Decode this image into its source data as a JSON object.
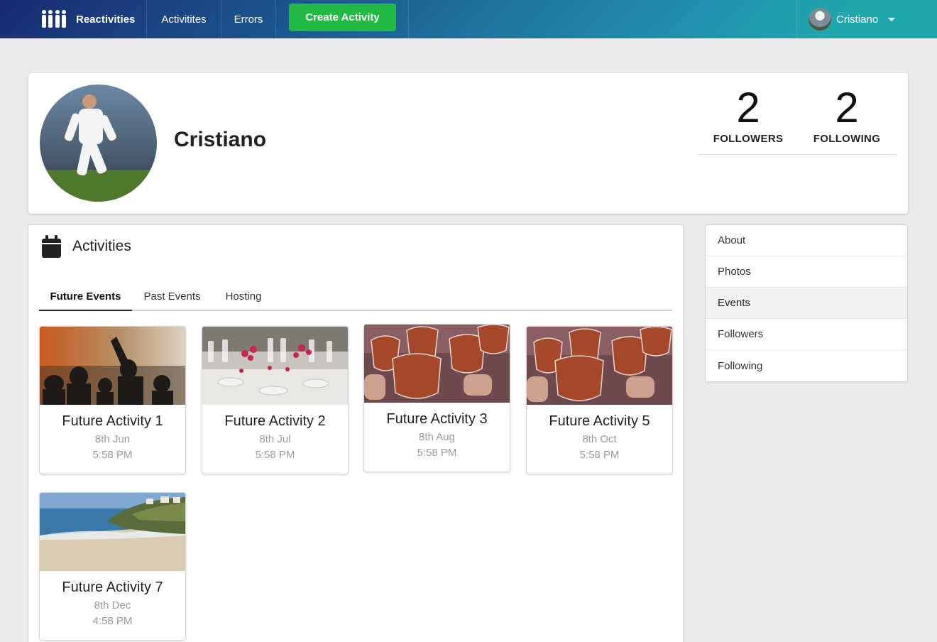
{
  "nav": {
    "brand": "Reactivities",
    "activities": "Activitites",
    "errors": "Errors",
    "create": "Create Activity",
    "user": "Cristiano"
  },
  "profile": {
    "name": "Cristiano",
    "followers_count": "2",
    "followers_label": "FOLLOWERS",
    "following_count": "2",
    "following_label": "FOLLOWING"
  },
  "activities": {
    "title": "Activities",
    "tabs": [
      "Future Events",
      "Past Events",
      "Hosting"
    ],
    "active_tab": "Future Events",
    "events": [
      {
        "title": "Future Activity 1",
        "date": "8th Jun",
        "time": "5:58 PM",
        "image": "concert"
      },
      {
        "title": "Future Activity 2",
        "date": "8th Jul",
        "time": "5:58 PM",
        "image": "dinner-table"
      },
      {
        "title": "Future Activity 3",
        "date": "8th Aug",
        "time": "5:58 PM",
        "image": "drinks"
      },
      {
        "title": "Future Activity 5",
        "date": "8th Oct",
        "time": "5:58 PM",
        "image": "drinks"
      },
      {
        "title": "Future Activity 7",
        "date": "8th Dec",
        "time": "4:58 PM",
        "image": "beach"
      }
    ]
  },
  "side_menu": {
    "items": [
      "About",
      "Photos",
      "Events",
      "Followers",
      "Following"
    ],
    "active": "Events"
  },
  "colors": {
    "nav_gradient_start": "#182a73",
    "nav_gradient_end": "#20a7ac",
    "create_button": "#21ba45",
    "page_background": "#eaeaea"
  }
}
